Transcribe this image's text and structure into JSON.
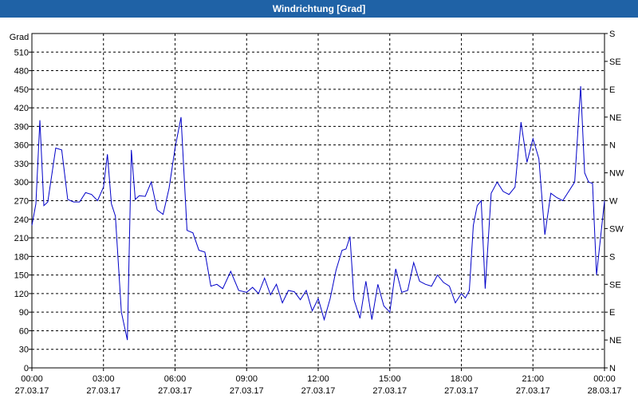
{
  "window": {
    "title": "Windrichtung [Grad]"
  },
  "chart_data": {
    "type": "line",
    "title": "Windrichtung [Grad]",
    "ylabel": "Grad",
    "ylim": [
      0,
      540
    ],
    "yticks": [
      0,
      30,
      60,
      90,
      120,
      150,
      180,
      210,
      240,
      270,
      300,
      330,
      360,
      390,
      420,
      450,
      480,
      510
    ],
    "y2ticks": [
      {
        "value": 0,
        "label": "N"
      },
      {
        "value": 45,
        "label": "NE"
      },
      {
        "value": 90,
        "label": "E"
      },
      {
        "value": 135,
        "label": "SE"
      },
      {
        "value": 180,
        "label": "S"
      },
      {
        "value": 225,
        "label": "SW"
      },
      {
        "value": 270,
        "label": "W"
      },
      {
        "value": 315,
        "label": "NW"
      },
      {
        "value": 360,
        "label": "N"
      },
      {
        "value": 405,
        "label": "NE"
      },
      {
        "value": 450,
        "label": "E"
      },
      {
        "value": 495,
        "label": "SE"
      },
      {
        "value": 540,
        "label": "S"
      }
    ],
    "xlim": [
      "27.03.17 00:00",
      "28.03.17 00:00"
    ],
    "xticks": [
      {
        "time": "00:00",
        "date": "27.03.17"
      },
      {
        "time": "03:00",
        "date": "27.03.17"
      },
      {
        "time": "06:00",
        "date": "27.03.17"
      },
      {
        "time": "09:00",
        "date": "27.03.17"
      },
      {
        "time": "12:00",
        "date": "27.03.17"
      },
      {
        "time": "15:00",
        "date": "27.03.17"
      },
      {
        "time": "18:00",
        "date": "27.03.17"
      },
      {
        "time": "21:00",
        "date": "27.03.17"
      },
      {
        "time": "00:00",
        "date": "28.03.17"
      }
    ],
    "grid": true,
    "line_color": "#0000c8",
    "series": [
      {
        "x": [
          "00:00",
          "00:10",
          "00:20",
          "00:30",
          "00:40",
          "01:00",
          "01:15",
          "01:30",
          "01:45",
          "02:00",
          "02:15",
          "02:30",
          "02:45",
          "03:00",
          "03:10",
          "03:20",
          "03:30",
          "03:45",
          "04:00",
          "04:05",
          "04:10",
          "04:20",
          "04:30",
          "04:45",
          "05:00",
          "05:15",
          "05:30",
          "05:45",
          "06:00",
          "06:15",
          "06:30",
          "06:45",
          "07:00",
          "07:15",
          "07:30",
          "07:45",
          "08:00",
          "08:20",
          "08:40",
          "09:00",
          "09:15",
          "09:30",
          "09:45",
          "10:00",
          "10:15",
          "10:30",
          "10:45",
          "11:00",
          "11:15",
          "11:30",
          "11:45",
          "12:00",
          "12:15",
          "12:30",
          "12:45",
          "13:00",
          "13:10",
          "13:20",
          "13:30",
          "13:45",
          "14:00",
          "14:15",
          "14:30",
          "14:45",
          "15:00",
          "15:15",
          "15:30",
          "15:45",
          "16:00",
          "16:15",
          "16:30",
          "16:45",
          "17:00",
          "17:15",
          "17:30",
          "17:45",
          "18:00",
          "18:10",
          "18:20",
          "18:30",
          "18:40",
          "18:50",
          "19:00",
          "19:15",
          "19:30",
          "19:45",
          "20:00",
          "20:15",
          "20:30",
          "20:45",
          "21:00",
          "21:15",
          "21:30",
          "21:45",
          "22:00",
          "22:15",
          "22:30",
          "22:45",
          "23:00",
          "23:10",
          "23:20",
          "23:30",
          "23:40",
          "23:50",
          "24:00"
        ],
        "y": [
          230,
          265,
          400,
          262,
          268,
          355,
          352,
          272,
          268,
          268,
          283,
          280,
          270,
          292,
          345,
          265,
          245,
          90,
          45,
          200,
          352,
          272,
          278,
          277,
          300,
          255,
          248,
          290,
          355,
          405,
          222,
          218,
          190,
          187,
          132,
          135,
          128,
          156,
          125,
          122,
          130,
          120,
          145,
          118,
          135,
          105,
          125,
          123,
          110,
          125,
          92,
          112,
          78,
          112,
          158,
          190,
          192,
          212,
          110,
          80,
          140,
          78,
          135,
          100,
          90,
          160,
          122,
          125,
          170,
          140,
          135,
          132,
          150,
          138,
          132,
          105,
          120,
          113,
          125,
          230,
          262,
          270,
          128,
          282,
          300,
          285,
          280,
          292,
          397,
          332,
          370,
          338,
          215,
          282,
          275,
          270,
          285,
          300,
          455,
          315,
          300,
          298,
          150,
          210,
          270
        ]
      }
    ]
  }
}
